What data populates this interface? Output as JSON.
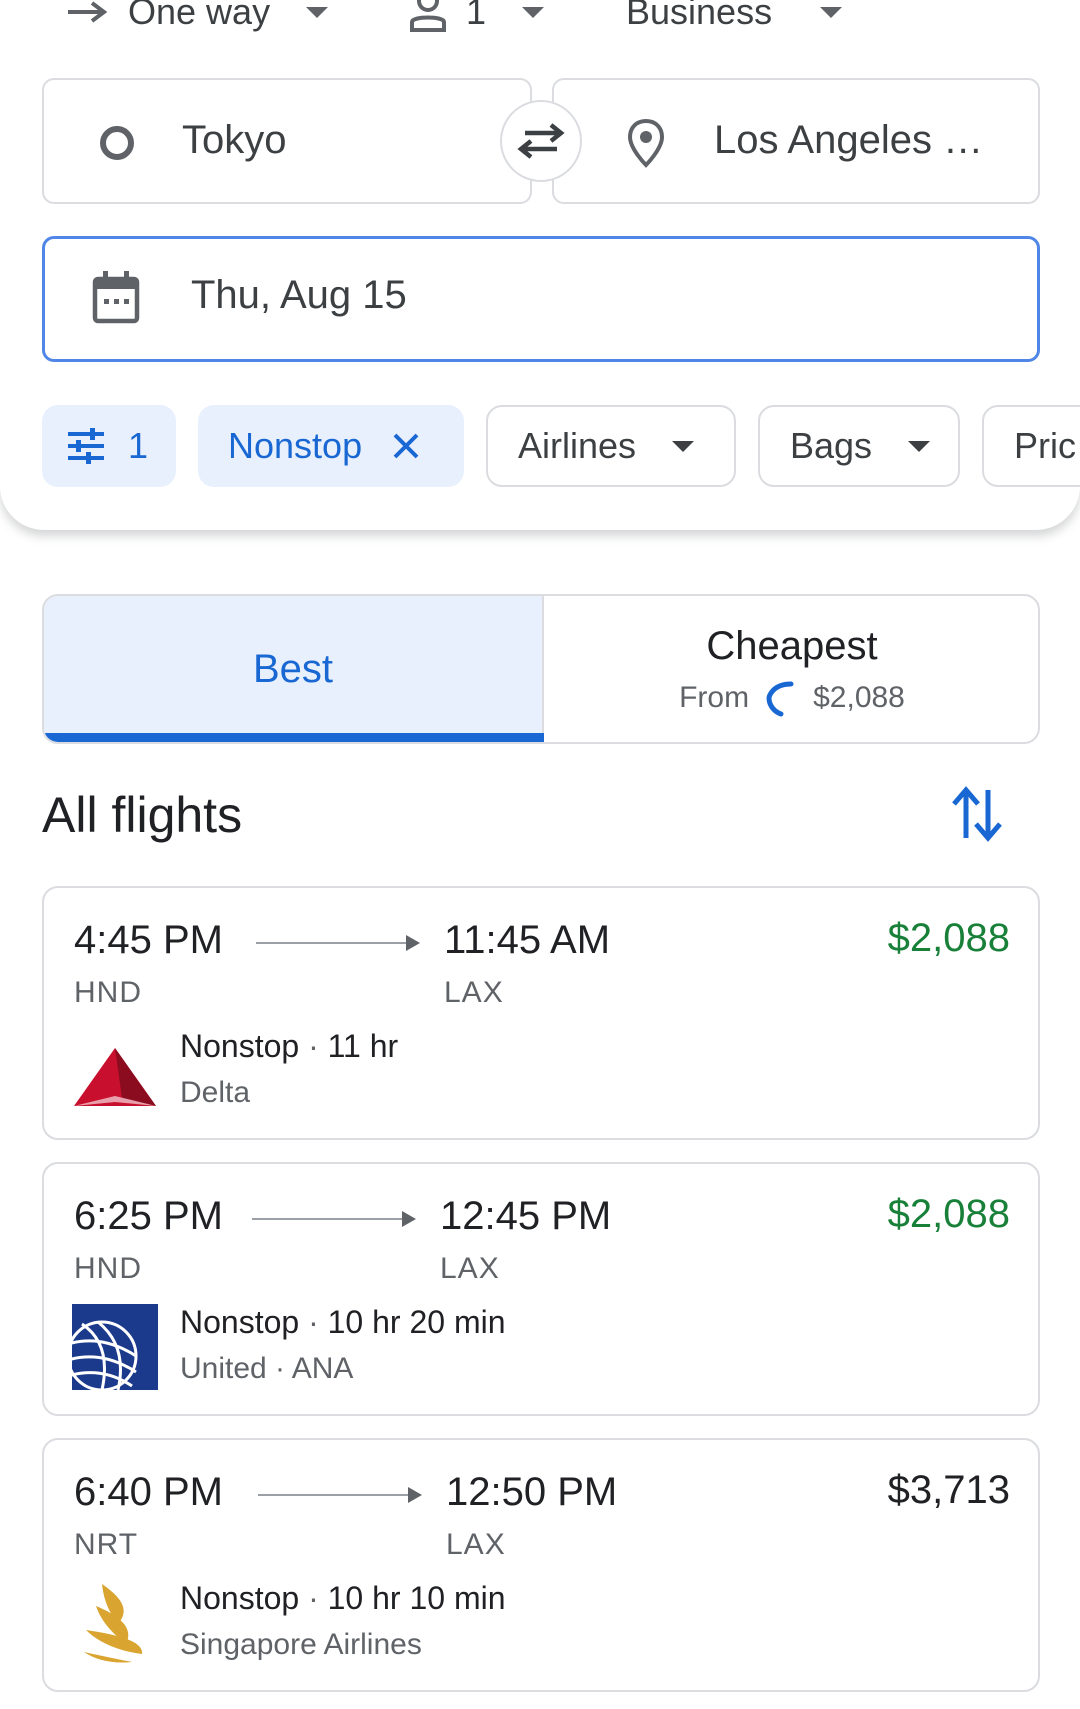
{
  "top_bar": {
    "trip_type": "One way",
    "passengers": "1",
    "cabin_class": "Business"
  },
  "search": {
    "origin": "Tokyo",
    "destination": "Los Angeles …",
    "date": "Thu, Aug 15"
  },
  "filters": {
    "all_filters_count": "1",
    "chips": [
      "Nonstop",
      "Airlines",
      "Bags",
      "Pric"
    ]
  },
  "sort_tabs": {
    "best_label": "Best",
    "cheapest_label": "Cheapest",
    "cheapest_from": "From",
    "cheapest_price": "$2,088"
  },
  "results": {
    "heading": "All flights",
    "flights": [
      {
        "depart_time": "4:45 PM",
        "arrive_time": "11:45 AM",
        "depart_code": "HND",
        "arrive_code": "LAX",
        "stops": "Nonstop",
        "duration": "11 hr",
        "airline": "Delta",
        "airline_extra": "",
        "price": "$2,088",
        "logo_icon": "delta-logo-icon"
      },
      {
        "depart_time": "6:25 PM",
        "arrive_time": "12:45 PM",
        "depart_code": "HND",
        "arrive_code": "LAX",
        "stops": "Nonstop",
        "duration": "10 hr 20 min",
        "airline": "United",
        "airline_extra": "ANA",
        "price": "$2,088",
        "logo_icon": "united-logo-icon"
      },
      {
        "depart_time": "6:40 PM",
        "arrive_time": "12:50 PM",
        "depart_code": "NRT",
        "arrive_code": "LAX",
        "stops": "Nonstop",
        "duration": "10 hr 10 min",
        "airline": "Singapore Airlines",
        "airline_extra": "",
        "price": "$3,713",
        "logo_icon": "singapore-airlines-logo-icon"
      }
    ]
  },
  "colors": {
    "accent_blue": "#1967d2",
    "price_green": "#188038",
    "delta_red": "#c8102e",
    "united_blue": "#1b3a8c",
    "singapore_gold": "#d9a530"
  }
}
